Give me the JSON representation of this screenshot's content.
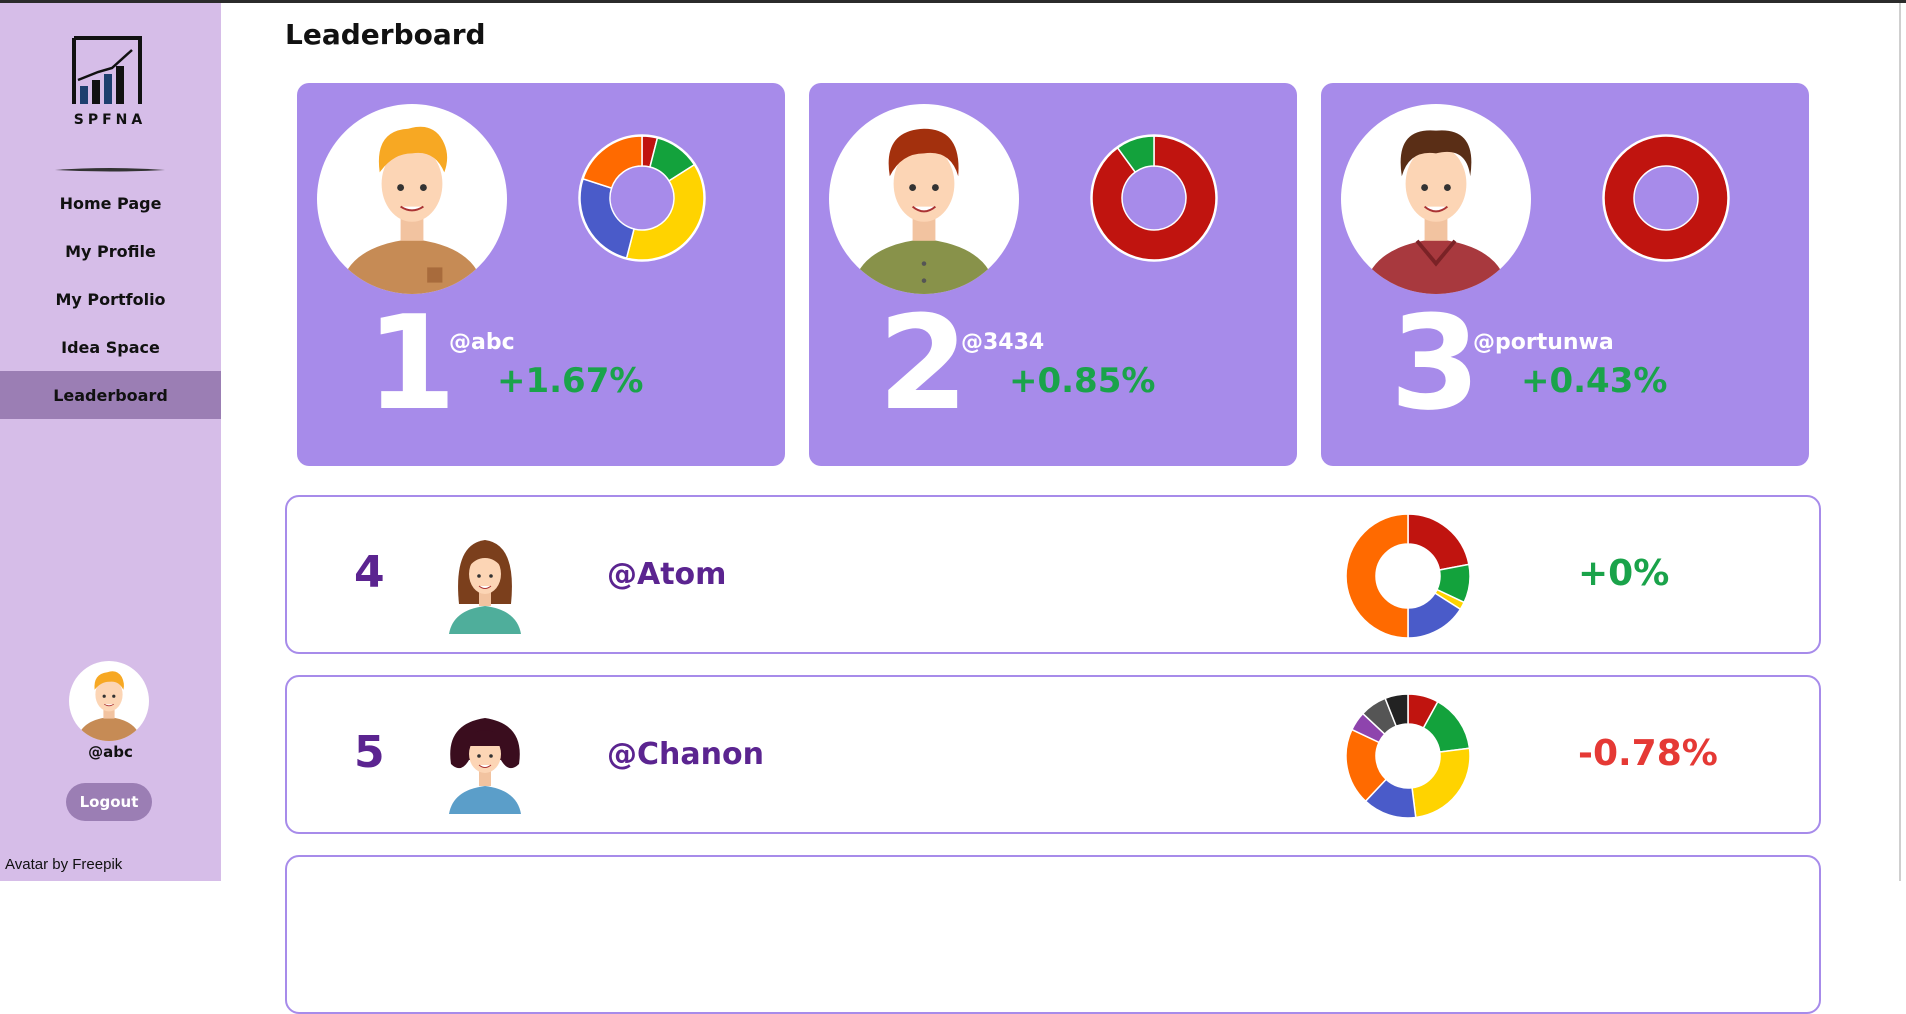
{
  "logo_text": "SPFNA",
  "page_title": "Leaderboard",
  "nav": [
    {
      "label": "Home Page",
      "active": false
    },
    {
      "label": "My Profile",
      "active": false
    },
    {
      "label": "My Portfolio",
      "active": false
    },
    {
      "label": "Idea Space",
      "active": false
    },
    {
      "label": "Leaderboard",
      "active": true
    }
  ],
  "user": {
    "handle": "@abc",
    "logout_label": "Logout"
  },
  "credit": "Avatar by Freepik",
  "colors": {
    "sidebar_bg": "#d6bde8",
    "active_nav": "#9b7eb4",
    "card_bg": "#a78bea",
    "rank_purple": "#5b2490",
    "positive": "#1aa34a",
    "negative": "#e53935"
  },
  "top_three": [
    {
      "rank": "1",
      "handle": "@abc",
      "change": "+1.67%",
      "avatar": "blond-man-avatar-icon",
      "donut": [
        {
          "color": "#c0140f",
          "value": 4
        },
        {
          "color": "#13a23c",
          "value": 12
        },
        {
          "color": "#ffd300",
          "value": 38
        },
        {
          "color": "#4a5bc9",
          "value": 26
        },
        {
          "color": "#ff6a00",
          "value": 20
        }
      ]
    },
    {
      "rank": "2",
      "handle": "@3434",
      "change": "+0.85%",
      "avatar": "red-hair-man-avatar-icon",
      "donut": [
        {
          "color": "#c0140f",
          "value": 90
        },
        {
          "color": "#13a23c",
          "value": 10
        }
      ]
    },
    {
      "rank": "3",
      "handle": "@portunwa",
      "change": "+0.43%",
      "avatar": "brown-hair-man-avatar-icon",
      "donut": [
        {
          "color": "#c0140f",
          "value": 100
        }
      ]
    }
  ],
  "rows": [
    {
      "rank": "4",
      "handle": "@Atom",
      "change": "+0%",
      "positive": true,
      "avatar": "brown-hair-woman-avatar-icon",
      "donut": [
        {
          "color": "#c0140f",
          "value": 22
        },
        {
          "color": "#13a23c",
          "value": 10
        },
        {
          "color": "#ffd300",
          "value": 2
        },
        {
          "color": "#4a5bc9",
          "value": 16
        },
        {
          "color": "#ff6a00",
          "value": 50
        }
      ]
    },
    {
      "rank": "5",
      "handle": "@Chanon",
      "change": "-0.78%",
      "positive": false,
      "avatar": "dark-hair-woman-avatar-icon",
      "donut": [
        {
          "color": "#c0140f",
          "value": 8
        },
        {
          "color": "#13a23c",
          "value": 15
        },
        {
          "color": "#ffd300",
          "value": 25
        },
        {
          "color": "#4a5bc9",
          "value": 14
        },
        {
          "color": "#ff6a00",
          "value": 20
        },
        {
          "color": "#8e44ad",
          "value": 5
        },
        {
          "color": "#555555",
          "value": 7
        },
        {
          "color": "#222222",
          "value": 6
        }
      ]
    }
  ]
}
